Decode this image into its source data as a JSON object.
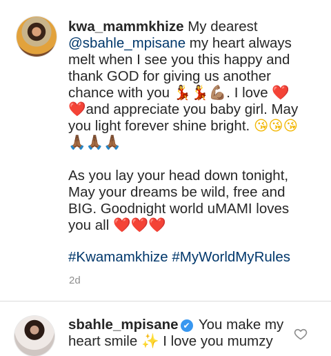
{
  "caption": {
    "username": "kwa_mammkhize",
    "text_1": " My dearest ",
    "mention": "@sbahle_mpisane",
    "text_2": " my heart always melt when I see you this happy and thank GOD for giving us another chance with you ",
    "emoji_dancers": "💃💃",
    "emoji_flex": "💪🏽",
    "text_3": ". I love ",
    "emoji_heart": "❤️",
    "emoji_heart2": "❤️",
    "text_4": "and appreciate you baby girl. May you light forever shine bright. ",
    "emoji_kiss": "😘😘😘",
    "emoji_pray": "🙏🏾🙏🏾🙏🏾",
    "para2": "As you lay your head down tonight, May your dreams be wild, free and BIG. Goodnight world uMAMI loves you all ",
    "emoji_hearts3": "❤️❤️❤️",
    "hashtags": "#Kwamamkhize #MyWorldMyRules",
    "time": "2d"
  },
  "reply": {
    "username": "sbahle_mpisane",
    "verified_icon": "✔",
    "text_1": " You make my heart smile ",
    "emoji_sparkle": "✨",
    "text_2": " I love you mumzy"
  },
  "icons": {
    "like": "heart-outline-icon"
  }
}
